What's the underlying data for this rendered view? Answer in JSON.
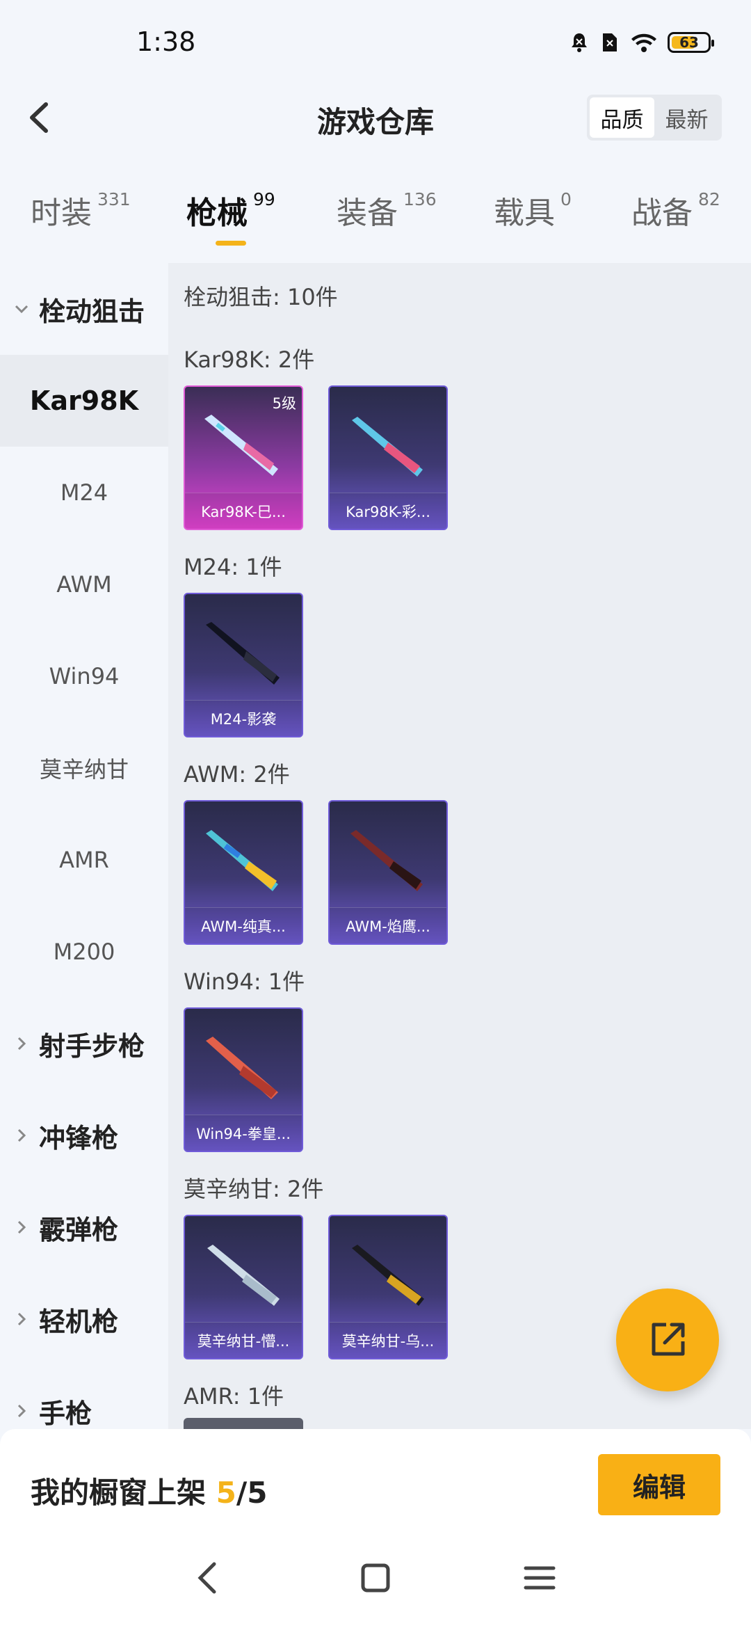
{
  "status": {
    "time": "1:38",
    "battery": "63"
  },
  "header": {
    "title": "游戏仓库",
    "sort_options": [
      "品质",
      "最新"
    ],
    "sort_selected": "品质"
  },
  "tabs": [
    {
      "label": "时装",
      "count": "331"
    },
    {
      "label": "枪械",
      "count": "99",
      "active": true
    },
    {
      "label": "装备",
      "count": "136"
    },
    {
      "label": "载具",
      "count": "0"
    },
    {
      "label": "战备",
      "count": "82"
    }
  ],
  "sidebar": {
    "groups": [
      {
        "label": "栓动狙击",
        "expanded": true,
        "items": [
          "Kar98K",
          "M24",
          "AWM",
          "Win94",
          "莫辛纳甘",
          "AMR",
          "M200"
        ],
        "selected": "Kar98K"
      },
      {
        "label": "射手步枪"
      },
      {
        "label": "冲锋枪"
      },
      {
        "label": "霰弹枪"
      },
      {
        "label": "轻机枪"
      },
      {
        "label": "手枪"
      }
    ]
  },
  "content": {
    "summary": "栓动狙击: 10件",
    "groups": [
      {
        "title": "Kar98K: 2件",
        "items": [
          {
            "name": "Kar98K-巳...",
            "level": "5级",
            "rarity": "legend"
          },
          {
            "name": "Kar98K-彩...",
            "rarity": "epic"
          }
        ]
      },
      {
        "title": "M24: 1件",
        "items": [
          {
            "name": "M24-影袭",
            "rarity": "epic"
          }
        ]
      },
      {
        "title": "AWM: 2件",
        "items": [
          {
            "name": "AWM-纯真...",
            "rarity": "epic"
          },
          {
            "name": "AWM-焰鹰...",
            "rarity": "epic"
          }
        ]
      },
      {
        "title": "Win94: 1件",
        "items": [
          {
            "name": "Win94-拳皇...",
            "rarity": "epic"
          }
        ]
      },
      {
        "title": "莫辛纳甘: 2件",
        "items": [
          {
            "name": "莫辛纳甘-懵...",
            "rarity": "epic"
          },
          {
            "name": "莫辛纳甘-乌...",
            "rarity": "epic"
          }
        ]
      },
      {
        "title": "AMR: 1件",
        "items": []
      }
    ]
  },
  "bottom": {
    "shelf_label": "我的橱窗上架 ",
    "shelf_current": "5",
    "shelf_total": "/5",
    "edit_label": "编辑"
  },
  "icons": [
    "back-arrow-icon",
    "share-icon",
    "chevron-down-icon",
    "chevron-right-icon",
    "nav-back-icon",
    "nav-home-icon",
    "nav-menu-icon"
  ],
  "colors": {
    "accent": "#f9b015",
    "epic": "#6f5bd8",
    "legend": "#e244d2"
  }
}
